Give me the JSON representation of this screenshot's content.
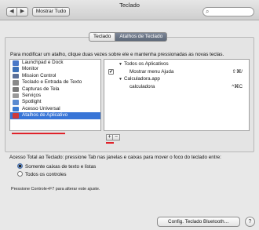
{
  "window": {
    "title": "Teclado"
  },
  "toolbar": {
    "back_glyph": "◀",
    "forward_glyph": "▶",
    "show_all_label": "Mostrar Tudo",
    "search_icon": "search-icon"
  },
  "tabs": [
    {
      "label": "Teclado",
      "selected": false
    },
    {
      "label": "Atalhos de Teclado",
      "selected": true
    }
  ],
  "instructions": "Para modificar um atalho, clique duas vezes sobre ele e mantenha pressionadas as novas teclas.",
  "categories": [
    {
      "label": "Launchpad e Dock",
      "icon": "launchpad-icon",
      "icon_color": "#4a78c8",
      "selected": false
    },
    {
      "label": "Monitor",
      "icon": "monitor-icon",
      "icon_color": "#3a6fb8",
      "selected": false
    },
    {
      "label": "Mission Control",
      "icon": "mission-control-icon",
      "icon_color": "#5a6f98",
      "selected": false
    },
    {
      "label": "Teclado e Entrada de Texto",
      "icon": "keyboard-icon",
      "icon_color": "#8a8a8a",
      "selected": false
    },
    {
      "label": "Capturas de Tela",
      "icon": "screenshot-icon",
      "icon_color": "#7a7a7a",
      "selected": false
    },
    {
      "label": "Serviços",
      "icon": "services-icon",
      "icon_color": "#9a9a9a",
      "selected": false
    },
    {
      "label": "Spotlight",
      "icon": "spotlight-icon",
      "icon_color": "#5a8ad0",
      "selected": false
    },
    {
      "label": "Acesso Universal",
      "icon": "accessibility-icon",
      "icon_color": "#3a7ad0",
      "selected": false
    },
    {
      "label": "Atalhos de Aplicativo",
      "icon": "app-shortcuts-icon",
      "icon_color": "#d03a3a",
      "selected": true
    }
  ],
  "shortcuts": [
    {
      "type": "group",
      "label": "Todos os Aplicativos",
      "checked": false
    },
    {
      "type": "item",
      "label": "Mostrar menu Ajuda",
      "checked": true,
      "key": "⇧⌘/"
    },
    {
      "type": "group",
      "label": "Calculadora.app",
      "checked": false
    },
    {
      "type": "item",
      "label": "calculadora",
      "checked": false,
      "key": "^⌘C"
    }
  ],
  "list_buttons": {
    "add": "+",
    "remove": "−"
  },
  "full_access": {
    "label": "Acesso Total ao Teclado: pressione Tab nas janelas e caixas para mover o foco do teclado entre:",
    "options": [
      {
        "label": "Somente caixas de texto e listas",
        "selected": true
      },
      {
        "label": "Todos os controles",
        "selected": false
      }
    ],
    "hint": "Pressione Controle+F7 para alterar este ajuste."
  },
  "footer": {
    "bluetooth_button": "Config. Teclado Bluetooth…",
    "help_label": "?"
  },
  "colors": {
    "selection": "#3875d7",
    "annotation_red": "#e0222a"
  }
}
